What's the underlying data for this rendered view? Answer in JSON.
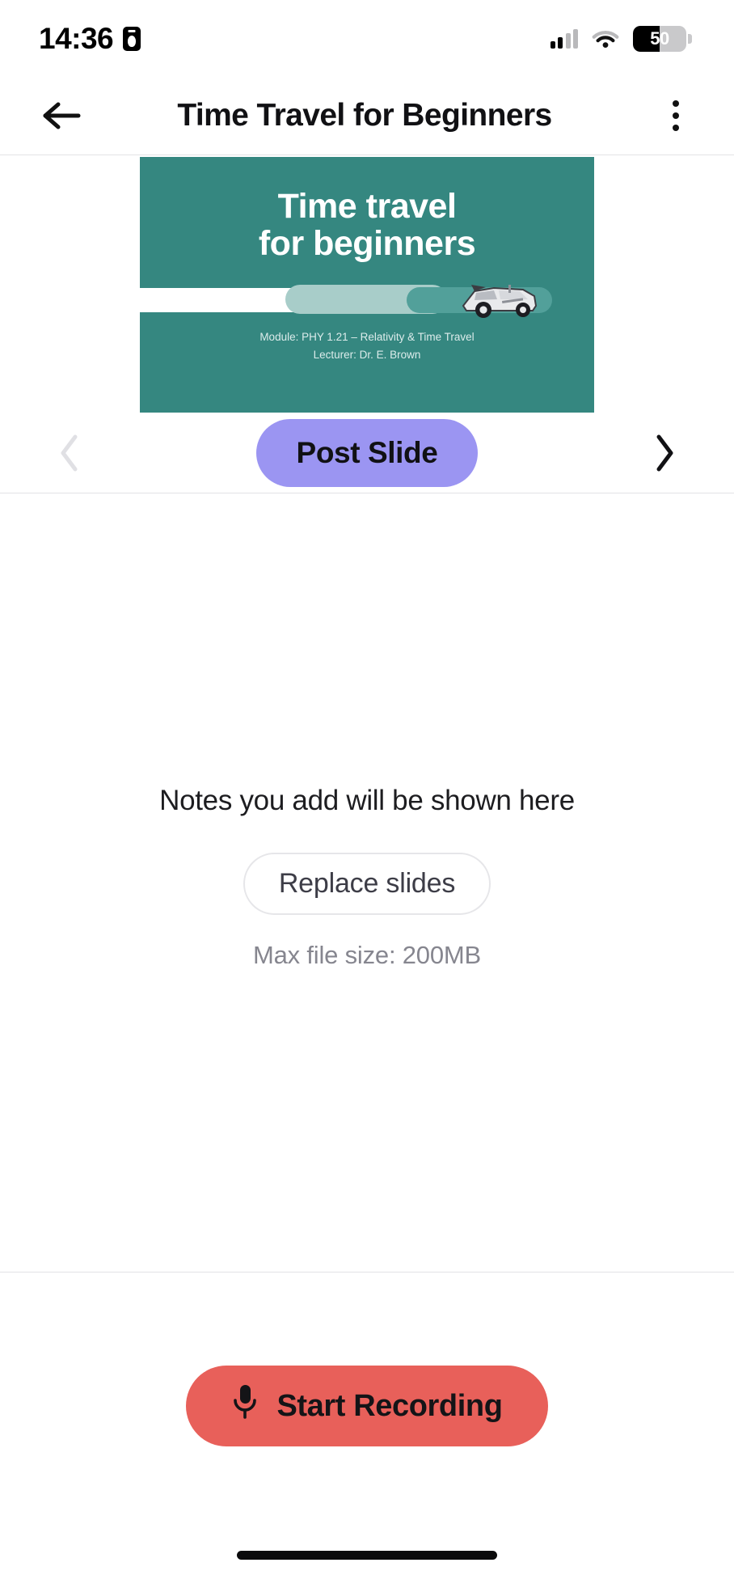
{
  "status_bar": {
    "time": "14:36",
    "recording_badge_icon": "screen-record-badge-icon",
    "signal_icon": "cellular-signal-icon",
    "signal_bars_active": 2,
    "signal_bars_total": 4,
    "wifi_icon": "wifi-icon",
    "battery_icon": "battery-icon",
    "battery_percent": "50",
    "battery_percent_filled_part": "5",
    "battery_percent_empty_part": "0"
  },
  "app_bar": {
    "back_icon": "back-arrow-icon",
    "title": "Time Travel for Beginners",
    "overflow_icon": "more-vertical-icon"
  },
  "slide": {
    "title_line1": "Time travel",
    "title_line2": "for beginners",
    "module": "Module: PHY 1.21 – Relativity & Time Travel",
    "lecturer": "Lecturer: Dr. E. Brown",
    "background_color": "#358780",
    "car_icon": "delorean-car-icon"
  },
  "slide_nav": {
    "prev_icon": "chevron-left-icon",
    "prev_enabled": false,
    "post_slide_label": "Post Slide",
    "post_slide_color": "#9b95f2",
    "next_icon": "chevron-right-icon",
    "next_enabled": true
  },
  "notes": {
    "empty_text": "Notes you add will be shown here",
    "replace_slides_label": "Replace slides",
    "max_file_size": "Max file size: 200MB"
  },
  "recording": {
    "mic_icon": "microphone-icon",
    "start_label": "Start Recording",
    "button_color": "#e8605a"
  },
  "home_indicator": {
    "name": "home-indicator"
  }
}
